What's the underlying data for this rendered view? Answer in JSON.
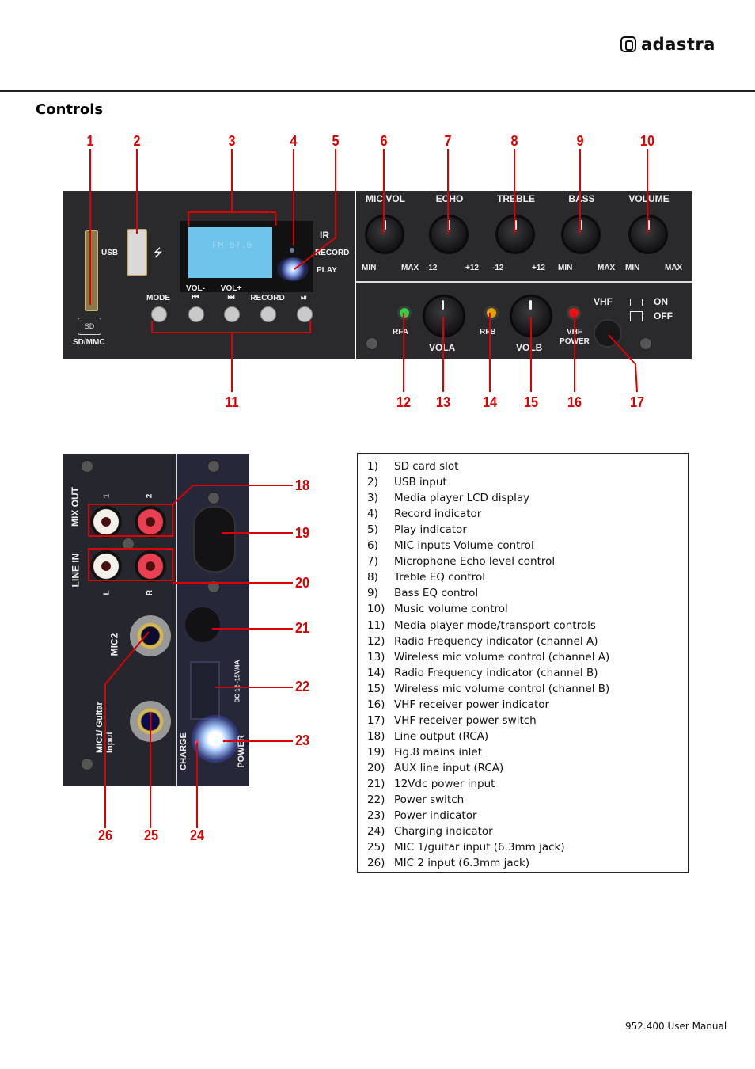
{
  "header": {
    "brand": "adastra",
    "section_title": "Controls"
  },
  "top_panel": {
    "callouts_top": [
      "1",
      "2",
      "3",
      "4",
      "5",
      "6",
      "7",
      "8",
      "9",
      "10"
    ],
    "callouts_bottom": [
      "11",
      "12",
      "13",
      "14",
      "15",
      "16",
      "17"
    ],
    "labels": {
      "usb": "USB",
      "sd": "SD",
      "sd_mmc": "SD/MMC",
      "ir": "IR",
      "record_ind": "RECORD",
      "play_ind": "PLAY",
      "lcd_text": "FM 87.5",
      "buttons": [
        "MODE",
        "VOL-\n⏮",
        "VOL+\n⏭",
        "RECORD",
        "⏯"
      ],
      "knobs": [
        "MIC VOL",
        "ECHO",
        "TREBLE",
        "BASS",
        "VOLUME"
      ],
      "knob_ranges": [
        [
          "MIN",
          "MAX"
        ],
        [
          "-12",
          "+12"
        ],
        [
          "-12",
          "+12"
        ],
        [
          "MIN",
          "MAX"
        ],
        [
          "MIN",
          "MAX"
        ]
      ],
      "rfa": "RFA",
      "rfb": "RFB",
      "vola": "VOLA",
      "volb": "VOLB",
      "vhf_power": "VHF POWER",
      "vhf": "VHF",
      "on": "ON",
      "off": "OFF"
    },
    "led_colors": {
      "rfa": "#33cc44",
      "rfb": "#e6a000",
      "vhf": "#ee1111"
    }
  },
  "rear_panel": {
    "callouts_right": [
      "18",
      "19",
      "20",
      "21",
      "22",
      "23"
    ],
    "callouts_bottom": [
      "26",
      "25",
      "24"
    ],
    "labels": {
      "mix_out": "MIX OUT",
      "line_in": "LINE IN",
      "ch1": "1",
      "ch2": "2",
      "l": "L",
      "r": "R",
      "mic2": "MIC2",
      "mic1": "MIC1/ Guitar Input",
      "charge": "CHARGE",
      "power": "POWER",
      "dc": "DC 12~15V/4A"
    }
  },
  "legend": {
    "items": [
      {
        "num": "1)",
        "text": "SD card slot"
      },
      {
        "num": "2)",
        "text": "USB input"
      },
      {
        "num": "3)",
        "text": "Media player LCD display"
      },
      {
        "num": "4)",
        "text": "Record indicator"
      },
      {
        "num": "5)",
        "text": "Play indicator"
      },
      {
        "num": "6)",
        "text": "MIC inputs Volume control"
      },
      {
        "num": "7)",
        "text": "Microphone Echo level control"
      },
      {
        "num": "8)",
        "text": "Treble EQ control"
      },
      {
        "num": "9)",
        "text": "Bass EQ control"
      },
      {
        "num": "10)",
        "text": "Music volume control"
      },
      {
        "num": "11)",
        "text": "Media player mode/transport controls"
      },
      {
        "num": "12)",
        "text": "Radio Frequency indicator (channel A)"
      },
      {
        "num": "13)",
        "text": "Wireless mic volume control (channel A)"
      },
      {
        "num": "14)",
        "text": "Radio Frequency indicator (channel B)"
      },
      {
        "num": "15)",
        "text": "Wireless mic volume control (channel B)"
      },
      {
        "num": "16)",
        "text": "VHF receiver power indicator"
      },
      {
        "num": "17)",
        "text": "VHF receiver power switch"
      },
      {
        "num": "18)",
        "text": "Line output (RCA)"
      },
      {
        "num": "19)",
        "text": "Fig.8 mains inlet"
      },
      {
        "num": "20)",
        "text": "AUX line input (RCA)"
      },
      {
        "num": "21)",
        "text": "12Vdc power input"
      },
      {
        "num": "22)",
        "text": "Power switch"
      },
      {
        "num": "23)",
        "text": "Power indicator"
      },
      {
        "num": "24)",
        "text": "Charging indicator"
      },
      {
        "num": "25)",
        "text": "MIC 1/guitar input (6.3mm jack)"
      },
      {
        "num": "26)",
        "text": "MIC 2 input (6.3mm jack)"
      }
    ]
  },
  "footer": {
    "manual": "952.400 User Manual"
  },
  "colors": {
    "callout_red": "#dd0000",
    "panel": "#2a2a2d"
  }
}
